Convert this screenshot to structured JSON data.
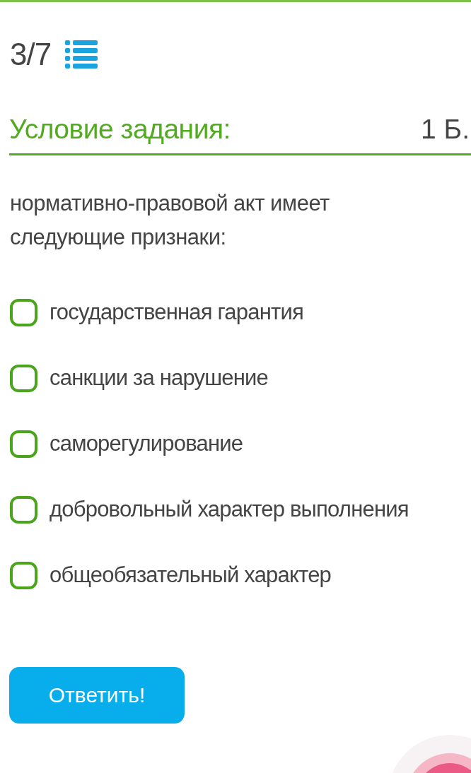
{
  "progress": {
    "counter": "3/7"
  },
  "task": {
    "heading": "Условие задания:",
    "points": "1 Б.",
    "question": "нормативно-правовой акт имеет следующие признаки:"
  },
  "options": [
    {
      "label": "государственная гарантия",
      "checked": false
    },
    {
      "label": "санкции за нарушение",
      "checked": false
    },
    {
      "label": "саморегулирование",
      "checked": false
    },
    {
      "label": "добровольный характер выполнения",
      "checked": false
    },
    {
      "label": "общеобязательный характер",
      "checked": false
    }
  ],
  "submit_button": "Ответить!"
}
